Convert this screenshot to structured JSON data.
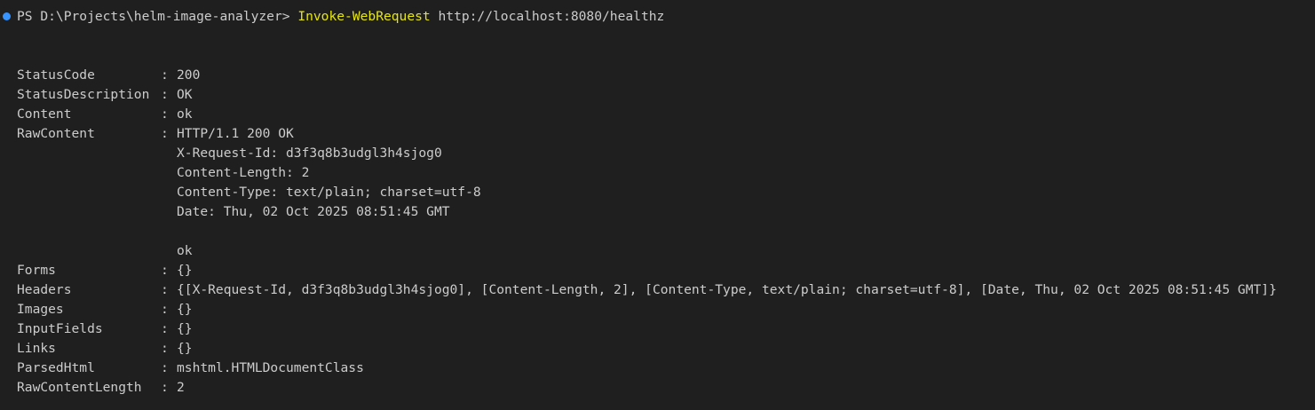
{
  "terminal": {
    "prompt": "PS D:\\Projects\\helm-image-analyzer>",
    "command": "Invoke-WebRequest",
    "argument": "http://localhost:8080/healthz"
  },
  "separator": ":",
  "rows": [
    {
      "name": "StatusCode",
      "value": "200"
    },
    {
      "name": "StatusDescription",
      "value": "OK"
    },
    {
      "name": "Content",
      "value": "ok"
    },
    {
      "name": "RawContent",
      "value": "HTTP/1.1 200 OK"
    }
  ],
  "raw_content_continued": [
    "X-Request-Id: d3f3q8b3udgl3h4sjog0",
    "Content-Length: 2",
    "Content-Type: text/plain; charset=utf-8",
    "Date: Thu, 02 Oct 2025 08:51:45 GMT",
    "",
    "ok"
  ],
  "rows2": [
    {
      "name": "Forms",
      "value": "{}"
    },
    {
      "name": "Headers",
      "value": "{[X-Request-Id, d3f3q8b3udgl3h4sjog0], [Content-Length, 2], [Content-Type, text/plain; charset=utf-8], [Date, Thu, 02 Oct 2025 08:51:45 GMT]}"
    },
    {
      "name": "Images",
      "value": "{}"
    },
    {
      "name": "InputFields",
      "value": "{}"
    },
    {
      "name": "Links",
      "value": "{}"
    },
    {
      "name": "ParsedHtml",
      "value": "mshtml.HTMLDocumentClass"
    },
    {
      "name": "RawContentLength",
      "value": "2"
    }
  ],
  "colors": {
    "background": "#1f1f1f",
    "text": "#cccccc",
    "command": "#e5e510",
    "status_dot": "#3794ff"
  }
}
